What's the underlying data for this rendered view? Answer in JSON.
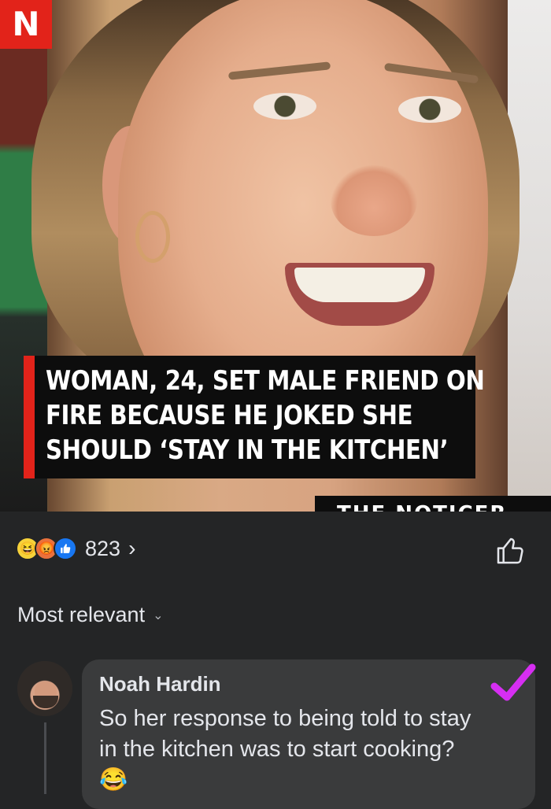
{
  "post": {
    "badge_letter": "N",
    "headline_lines": [
      "WOMAN, 24, SET MALE FRIEND ON",
      "FIRE BECAUSE HE JOKED SHE",
      "SHOULD ‘STAY IN THE KITCHEN’"
    ],
    "watermark": "THE NOTICER"
  },
  "reactions": {
    "icons": [
      "haha-reaction-icon",
      "angry-reaction-icon",
      "like-reaction-icon"
    ],
    "count": "823",
    "chevron": "›"
  },
  "sort": {
    "label": "Most relevant",
    "chevron": "⌄"
  },
  "comment": {
    "author": "Noah Hardin",
    "text": "So her response to being told to stay in the kitchen was to start cooking?😂",
    "checkmark_color": "#d62ef2"
  },
  "colors": {
    "background": "#242526",
    "bubble": "#3a3b3c",
    "badge": "#e2231a",
    "like": "#1877f2"
  }
}
